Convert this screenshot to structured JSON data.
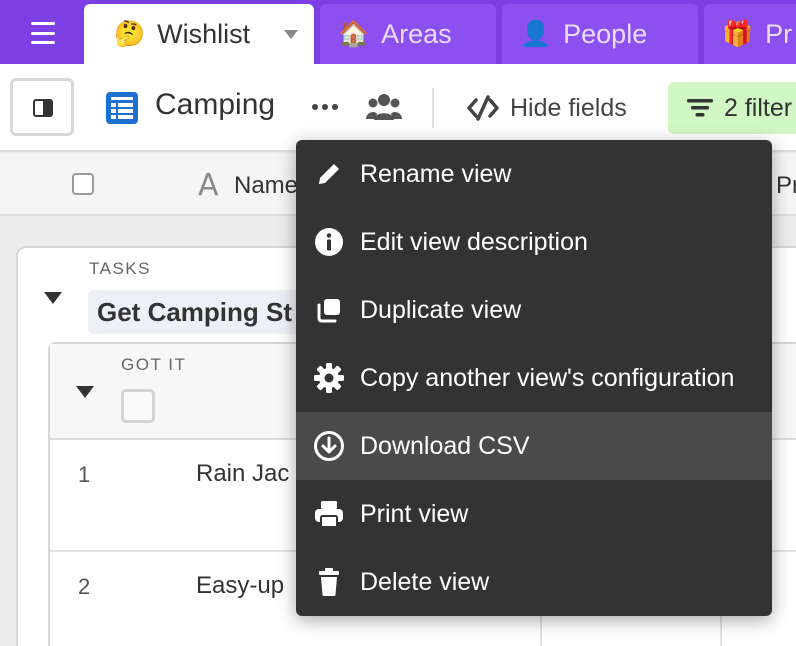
{
  "tabs": [
    {
      "emoji": "🤔",
      "label": "Wishlist",
      "active": true
    },
    {
      "emoji": "🏠",
      "label": "Areas",
      "active": false
    },
    {
      "emoji": "👤",
      "label": "People",
      "active": false
    },
    {
      "emoji": "🎁",
      "label": "Pr",
      "active": false
    }
  ],
  "toolbar": {
    "view_name": "Camping",
    "hide_fields_label": "Hide fields",
    "filter_label": "2 filter"
  },
  "header": {
    "name_icon_glyph": "A",
    "name_label": "Name",
    "next_col_label": "Pr"
  },
  "group": {
    "field_label": "TASKS",
    "value": "Get Camping St"
  },
  "subgroup": {
    "field_label": "GOT IT"
  },
  "rows": [
    {
      "num": "1",
      "text": "Rain Jac"
    },
    {
      "num": "2",
      "text": "Easy-up"
    }
  ],
  "menu": {
    "items": [
      {
        "label": "Rename view",
        "icon": "pencil-icon"
      },
      {
        "label": "Edit view description",
        "icon": "info-icon"
      },
      {
        "label": "Duplicate view",
        "icon": "duplicate-icon"
      },
      {
        "label": "Copy another view's configuration",
        "icon": "gear-icon"
      },
      {
        "label": "Download CSV",
        "icon": "download-icon",
        "highlighted": true
      },
      {
        "label": "Print view",
        "icon": "printer-icon"
      },
      {
        "label": "Delete view",
        "icon": "trash-icon"
      }
    ]
  },
  "colors": {
    "tabbar": "#7b3fe4",
    "filter_bg": "#d1f7c4",
    "grid_icon": "#1d6fd1",
    "menu_bg": "#333333",
    "menu_highlight": "#4a4a4a"
  }
}
